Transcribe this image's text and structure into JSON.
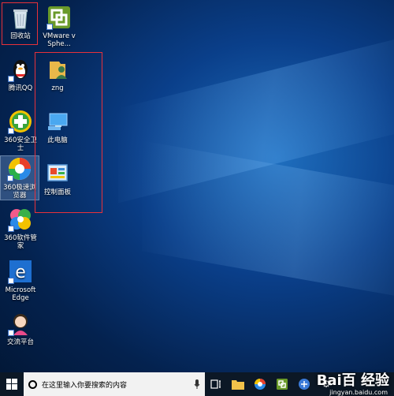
{
  "desktop": {
    "icons": [
      {
        "label": "回收站"
      },
      {
        "label": "VMware vSphe..."
      },
      {
        "label": "腾讯QQ"
      },
      {
        "label": "zng"
      },
      {
        "label": "360安全卫士"
      },
      {
        "label": "此电脑"
      },
      {
        "label": "360极速浏览器"
      },
      {
        "label": "控制面板"
      },
      {
        "label": "360软件管家"
      },
      {
        "label": "Microsoft Edge"
      },
      {
        "label": "交流平台"
      }
    ]
  },
  "taskbar": {
    "search_placeholder": "在这里输入你要搜索的内容"
  },
  "watermark": {
    "brand": "Bai百 经验",
    "url": "jingyan.baidu.com"
  },
  "colors": {
    "highlight_box": "#e8313a",
    "taskbar": "#0c1826"
  }
}
